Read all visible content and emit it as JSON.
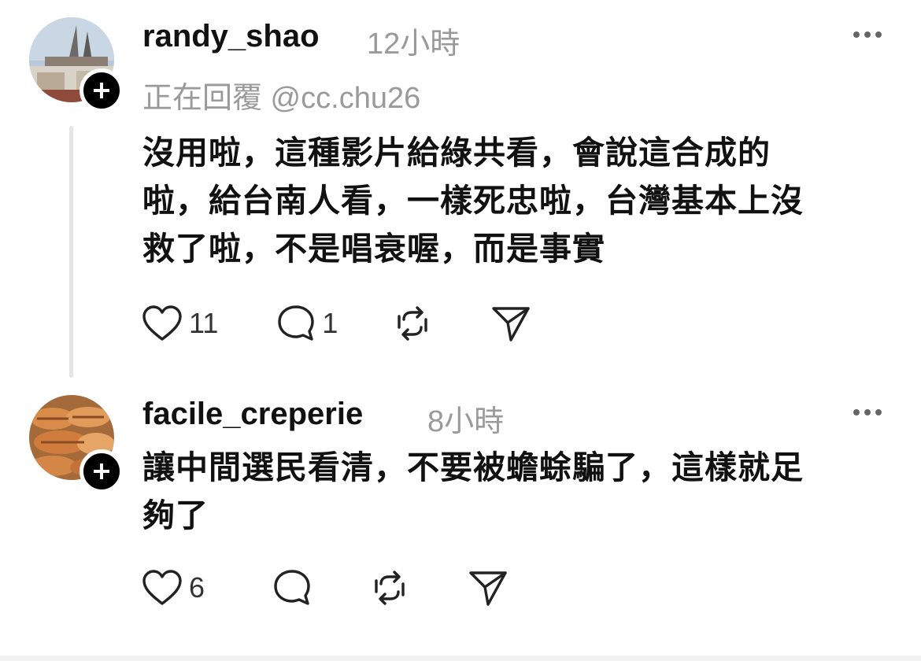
{
  "posts": [
    {
      "username": "randy_shao",
      "time": "12小時",
      "reply_to": "正在回覆 @cc.chu26",
      "content_lines": [
        "沒用啦，這種影片給綠共看，會說這合成的",
        "啦，給台南人看，一樣死忠啦，台灣基本上沒",
        "救了啦，不是唱衰喔，而是事實"
      ],
      "likes": "11",
      "replies": "1"
    },
    {
      "username": "facile_creperie",
      "time": "8小時",
      "content_lines": [
        "讓中間選民看清，不要被蟾蜍騙了，這樣就足",
        "夠了"
      ],
      "likes": "6"
    }
  ],
  "icons": {
    "like": "heart-icon",
    "reply": "comment-icon",
    "repost": "repost-icon",
    "share": "send-icon",
    "more": "more-icon",
    "follow": "plus-icon"
  }
}
